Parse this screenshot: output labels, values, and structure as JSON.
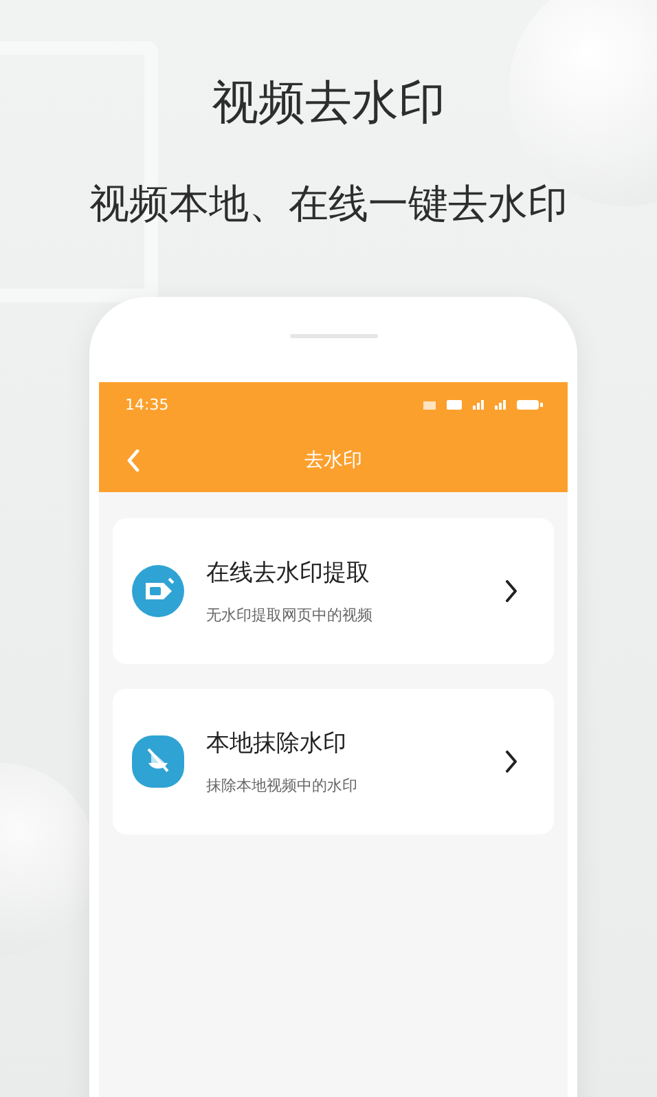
{
  "headline": "视频去水印",
  "subtitle": "视频本地、在线一键去水印",
  "status_bar": {
    "time": "14:35"
  },
  "nav_bar": {
    "title": "去水印"
  },
  "options": [
    {
      "kind": "online",
      "title": "在线去水印提取",
      "description": "无水印提取网页中的视频"
    },
    {
      "kind": "local",
      "title": "本地抹除水印",
      "description": "抹除本地视频中的水印"
    }
  ]
}
